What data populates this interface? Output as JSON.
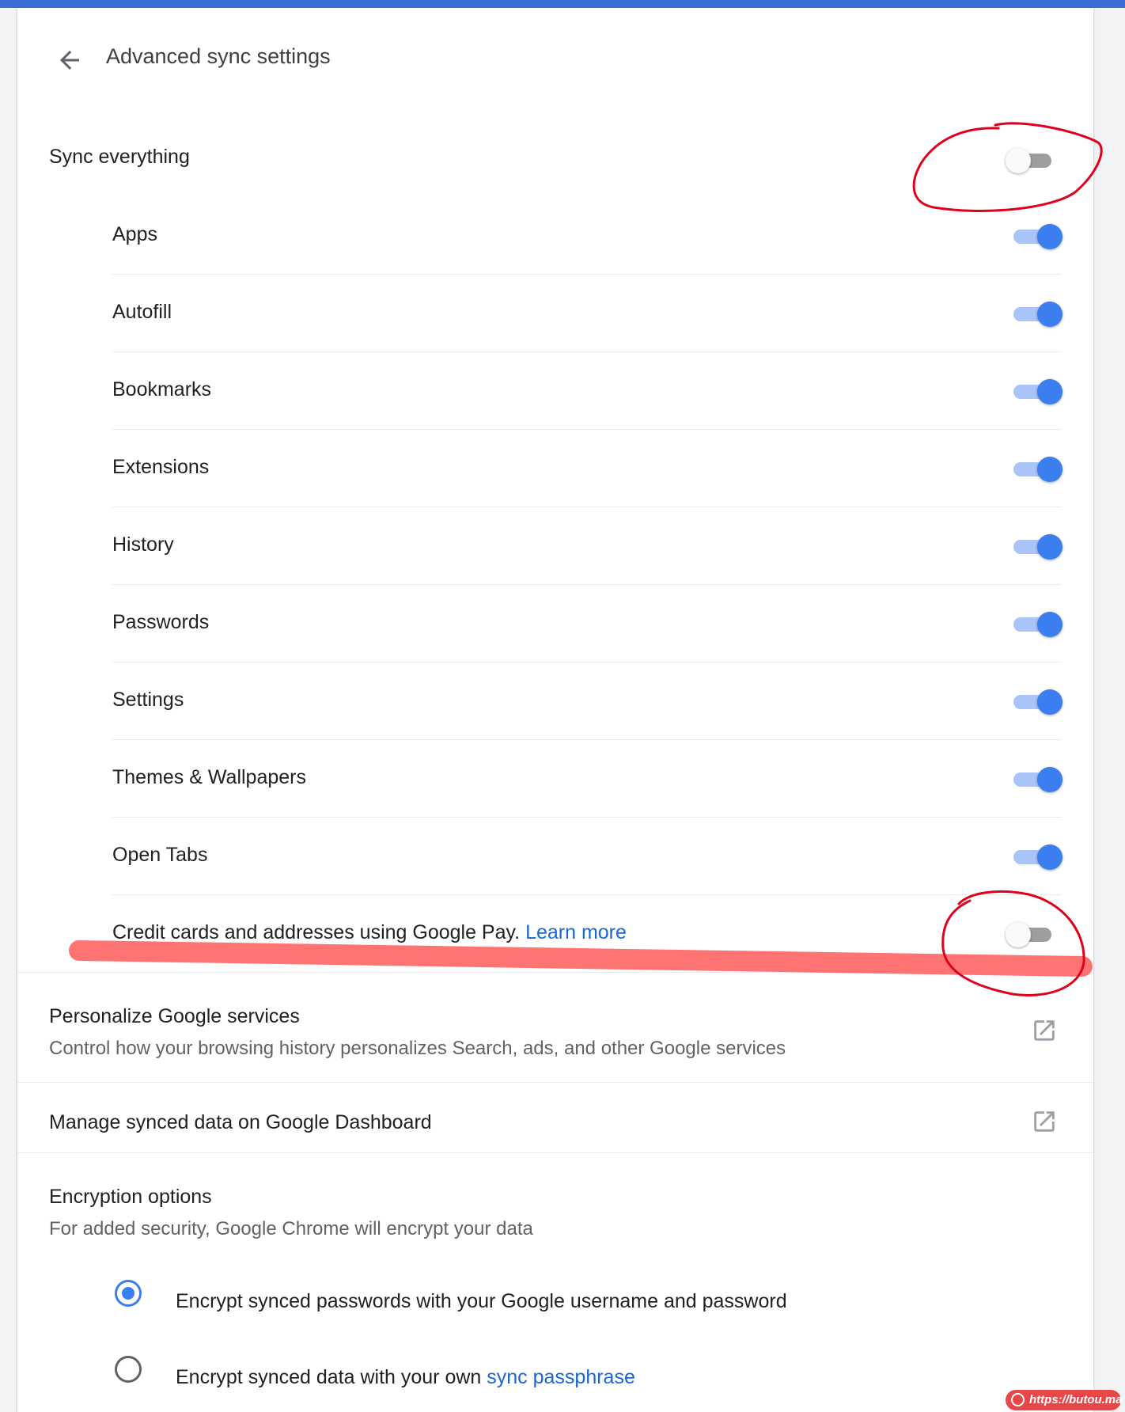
{
  "header": {
    "title": "Advanced sync settings",
    "back_icon": "arrow-back-icon"
  },
  "sync_everything": {
    "label": "Sync everything",
    "enabled": false
  },
  "sync_items": [
    {
      "label": "Apps",
      "enabled": true
    },
    {
      "label": "Autofill",
      "enabled": true
    },
    {
      "label": "Bookmarks",
      "enabled": true
    },
    {
      "label": "Extensions",
      "enabled": true
    },
    {
      "label": "History",
      "enabled": true
    },
    {
      "label": "Passwords",
      "enabled": true
    },
    {
      "label": "Settings",
      "enabled": true
    },
    {
      "label": "Themes & Wallpapers",
      "enabled": true
    },
    {
      "label": "Open Tabs",
      "enabled": true
    }
  ],
  "credit_cards": {
    "label": "Credit cards and addresses using Google Pay.",
    "link": "Learn more",
    "enabled": false
  },
  "personalize": {
    "title": "Personalize Google services",
    "description": "Control how your browsing history personalizes Search, ads, and other Google services",
    "icon": "open-in-new-icon"
  },
  "dashboard": {
    "title": "Manage synced data on Google Dashboard",
    "icon": "open-in-new-icon"
  },
  "encryption": {
    "title": "Encryption options",
    "description": "For added security, Google Chrome will encrypt your data",
    "options": [
      {
        "text": "Encrypt synced passwords with your Google username and password",
        "selected": true
      },
      {
        "text": "Encrypt synced data with your own",
        "link": "sync passphrase",
        "selected": false
      }
    ]
  },
  "watermark": {
    "text": "https://butou.ma"
  },
  "colors": {
    "accent": "#3b7ef0",
    "link": "#1a66d6",
    "annotation": "#e0001b",
    "highlight": "#ff7373"
  }
}
